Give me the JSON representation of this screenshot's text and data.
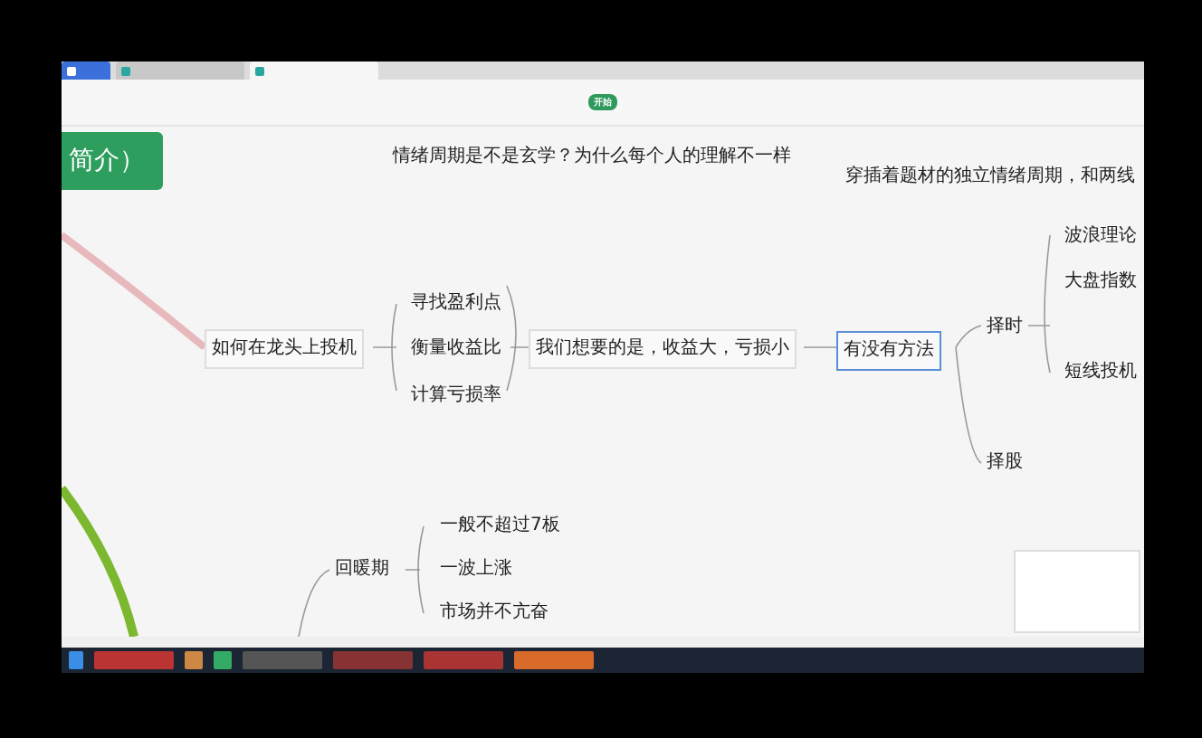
{
  "tabs": [
    {
      "kind": "home",
      "selected": false
    },
    {
      "kind": "doc",
      "selected": false
    },
    {
      "kind": "doc",
      "selected": true
    }
  ],
  "menu": [
    {
      "label": "开始",
      "selected": true
    }
  ],
  "nodes": [
    {
      "text": "简介）",
      "kind": "root"
    },
    {
      "text": "情绪周期是不是玄学？为什么每个人的理解不一样",
      "kind": "plain"
    },
    {
      "text": "穿插着题材的独立情绪周期，和两线",
      "kind": "plain"
    },
    {
      "text": "如何在龙头上投机",
      "kind": "box"
    },
    {
      "text": "寻找盈利点",
      "kind": "plain"
    },
    {
      "text": "衡量收益比",
      "kind": "plain"
    },
    {
      "text": "计算亏损率",
      "kind": "plain"
    },
    {
      "text": "我们想要的是，收益大，亏损小",
      "kind": "box"
    },
    {
      "text": "有没有方法",
      "kind": "focus"
    },
    {
      "text": "择时",
      "kind": "plain"
    },
    {
      "text": "波浪理论",
      "kind": "plain"
    },
    {
      "text": "大盘指数",
      "kind": "plain"
    },
    {
      "text": "短线投机",
      "kind": "plain"
    },
    {
      "text": "择股",
      "kind": "plain"
    },
    {
      "text": "回暖期",
      "kind": "plain"
    },
    {
      "text": "一般不超过7板",
      "kind": "plain"
    },
    {
      "text": "一波上涨",
      "kind": "plain"
    },
    {
      "text": "市场并不亢奋",
      "kind": "plain"
    }
  ]
}
